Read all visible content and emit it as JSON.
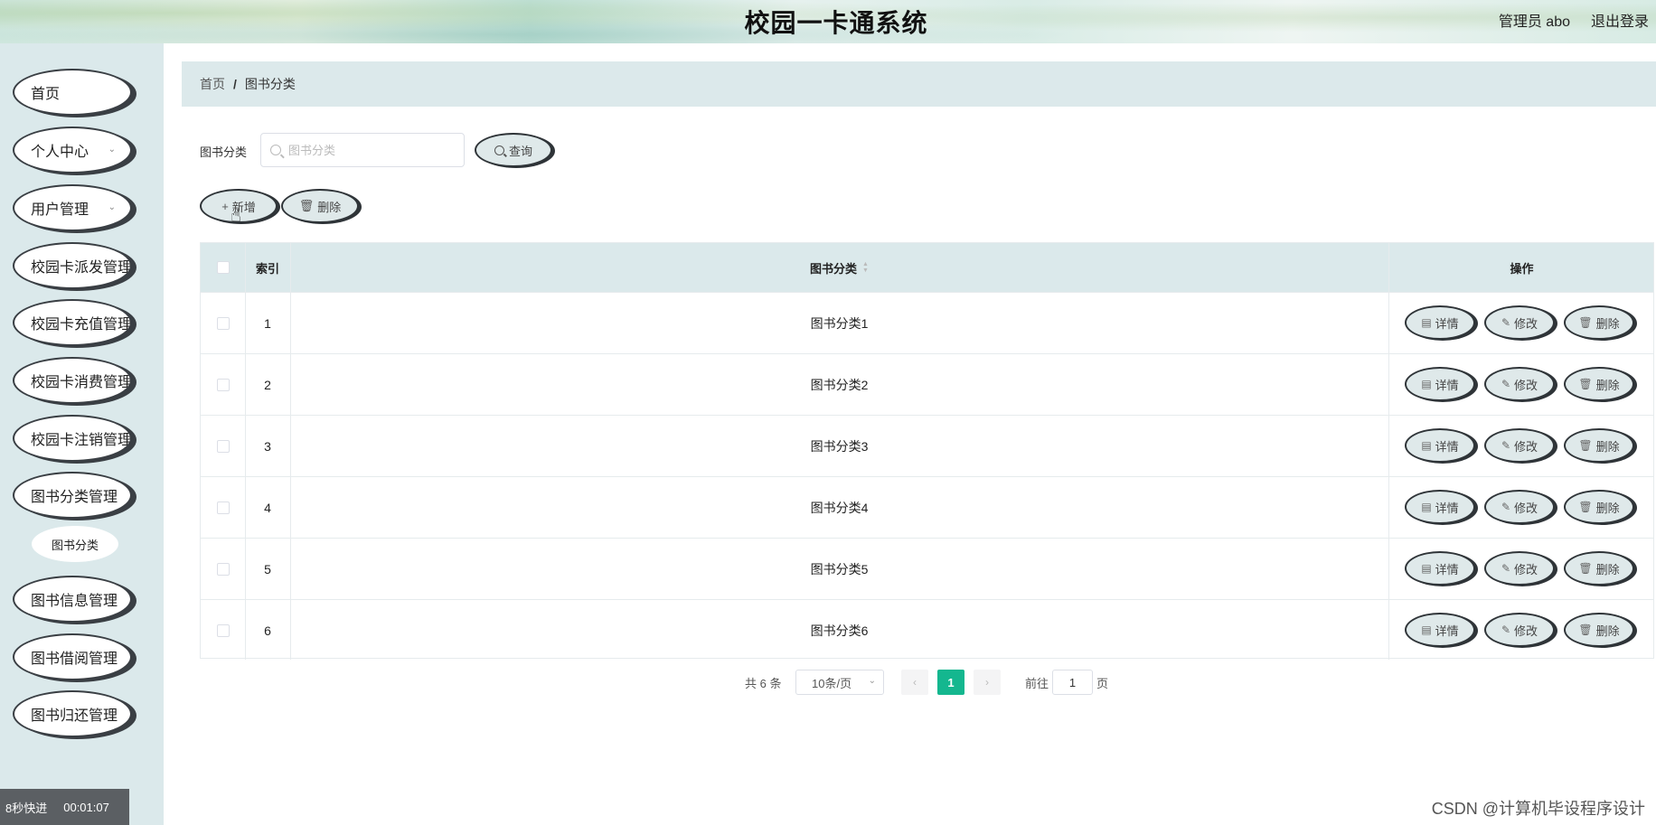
{
  "header": {
    "title": "校园一卡通系统",
    "admin": "管理员 abo",
    "logout": "退出登录"
  },
  "sidebar": {
    "items": [
      {
        "label": "首页"
      },
      {
        "label": "个人中心"
      },
      {
        "label": "用户管理"
      },
      {
        "label": "校园卡派发管理"
      },
      {
        "label": "校园卡充值管理"
      },
      {
        "label": "校园卡消费管理"
      },
      {
        "label": "校园卡注销管理"
      },
      {
        "label": "图书分类管理"
      },
      {
        "label": "图书信息管理"
      },
      {
        "label": "图书借阅管理"
      },
      {
        "label": "图书归还管理"
      }
    ],
    "active_sub": "图书分类"
  },
  "breadcrumb": {
    "home": "首页",
    "separator": "/",
    "current": "图书分类"
  },
  "search": {
    "label": "图书分类",
    "placeholder": "图书分类",
    "value": "",
    "button": "查询"
  },
  "toolbar": {
    "add": "新增",
    "delete": "删除"
  },
  "table": {
    "columns": {
      "index": "索引",
      "category": "图书分类",
      "actions": "操作"
    },
    "rows": [
      {
        "index": "1",
        "category": "图书分类1"
      },
      {
        "index": "2",
        "category": "图书分类2"
      },
      {
        "index": "3",
        "category": "图书分类3"
      },
      {
        "index": "4",
        "category": "图书分类4"
      },
      {
        "index": "5",
        "category": "图书分类5"
      },
      {
        "index": "6",
        "category": "图书分类6"
      }
    ],
    "actions": {
      "detail": "详情",
      "edit": "修改",
      "delete": "删除"
    }
  },
  "pagination": {
    "total": "共 6 条",
    "page_size": "10条/页",
    "current_page": "1",
    "goto_label": "前往",
    "goto_value": "1",
    "goto_suffix": "页"
  },
  "overlay": {
    "speed": "8秒快进",
    "time": "00:01:07",
    "watermark": "CSDN @计算机毕设程序设计"
  },
  "colors": {
    "accent": "#14b78f",
    "sidebar_bg": "#dbe9eb",
    "header_bg": "#dbe9eb"
  }
}
